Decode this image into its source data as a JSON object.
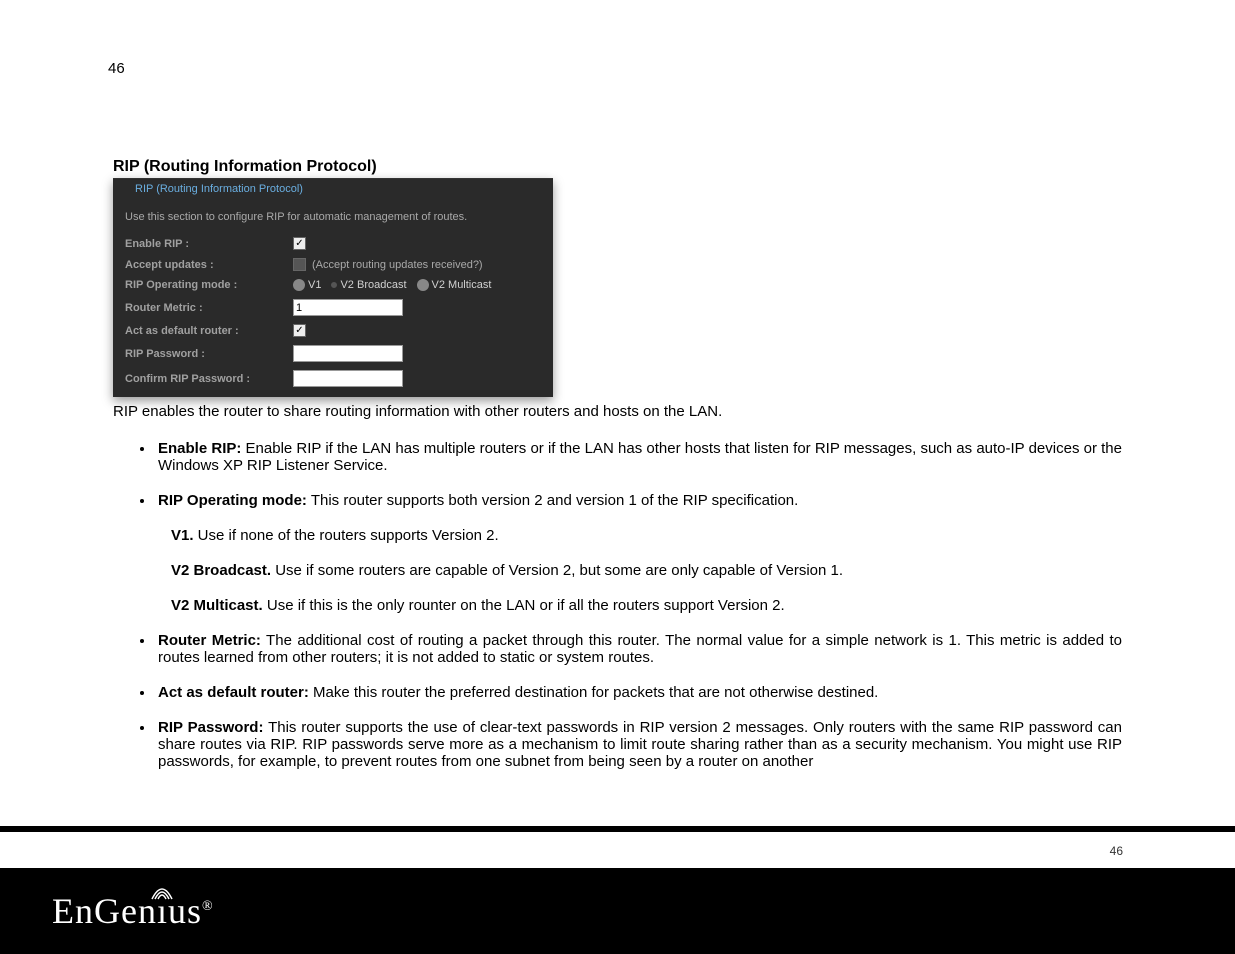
{
  "page_number_top": "46",
  "section_heading": "RIP (Routing Information Protocol)",
  "panel": {
    "header": "RIP (Routing Information Protocol)",
    "description": "Use this section to configure RIP for automatic management of routes.",
    "labels": {
      "enable_rip": "Enable RIP :",
      "accept_updates": "Accept updates :",
      "accept_updates_hint": "(Accept routing updates received?)",
      "operating_mode": "RIP Operating mode :",
      "router_metric": "Router Metric :",
      "act_default": "Act as default router :",
      "rip_password": "RIP Password :",
      "confirm_rip_password": "Confirm RIP Password :"
    },
    "radio": {
      "v1": "V1",
      "v2b": "V2 Broadcast",
      "v2m": "V2 Multicast"
    },
    "router_metric_value": "1"
  },
  "intro_text": "RIP enables the router to share routing information with other routers and hosts on the LAN.",
  "bullets": {
    "b1_label": "Enable RIP:",
    "b1_text": " Enable RIP if the LAN has multiple routers or if the LAN has other hosts that listen for RIP messages, such as auto-IP devices or the Windows XP RIP Listener Service.",
    "b2_label": "RIP Operating mode:",
    "b2_text": " This router supports both version 2 and version 1 of the RIP specification.",
    "b2_sub1_label": "V1.",
    "b2_sub1_text": " Use if none of the routers supports Version 2.",
    "b2_sub2_label": "V2 Broadcast.",
    "b2_sub2_text": " Use if some routers are capable of Version 2, but some are only capable of Version 1.",
    "b2_sub3_label": "V2 Multicast.",
    "b2_sub3_text": " Use if this is the only rounter on the LAN or if all the routers support Version 2.",
    "b3_label": "Router Metric:",
    "b3_text": " The additional cost of routing a packet through this router. The normal value for a simple network is 1. This metric is added to routes learned from other routers; it is not added to static or system routes.",
    "b4_label": "Act as default router:",
    "b4_text": " Make this router the preferred destination for packets that are not otherwise destined.",
    "b5_label": "RIP Password:",
    "b5_text": " This router supports the use of clear-text passwords in RIP version 2 messages. Only routers with the same RIP password can share routes via RIP. RIP passwords serve more as a mechanism to limit route sharing rather than as a security mechanism. You might use RIP passwords, for example, to prevent routes from one subnet from being seen by a router on another"
  },
  "footer_page": "46",
  "logo_text_pre": "EnGen",
  "logo_text_i": "ı",
  "logo_text_post": "us",
  "logo_reg": "®"
}
